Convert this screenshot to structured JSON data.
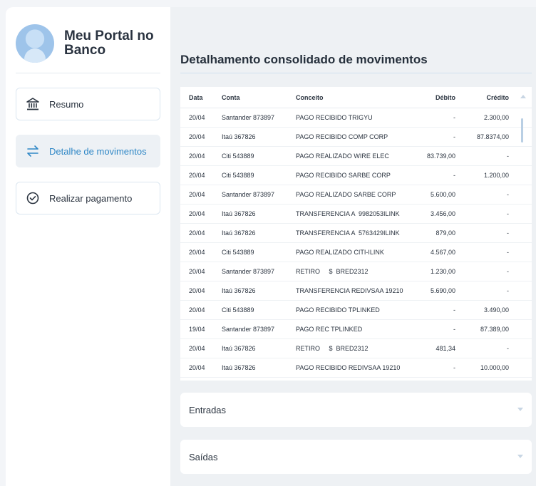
{
  "sidebar": {
    "brand": "Meu Portal no Banco",
    "items": [
      {
        "label": "Resumo",
        "icon": "bank-icon"
      },
      {
        "label": "Detalhe de movimentos",
        "icon": "transfer-arrows-icon"
      },
      {
        "label": "Realizar pagamento",
        "icon": "check-circle-icon"
      }
    ]
  },
  "main": {
    "title": "Detalhamento consolidado de movimentos",
    "table": {
      "headers": [
        "Data",
        "Conta",
        "Conceito",
        "Débito",
        "Crédito"
      ],
      "rows": [
        [
          "20/04",
          "Santander 873897",
          "PAGO RECIBIDO TRIGYU",
          "-",
          "2.300,00"
        ],
        [
          "20/04",
          "Itaú 367826",
          "PAGO RECIBIDO COMP CORP",
          "-",
          "87.8374,00"
        ],
        [
          "20/04",
          "Citi 543889",
          "PAGO REALIZADO WIRE ELEC",
          "83.739,00",
          "-"
        ],
        [
          "20/04",
          "Citi 543889",
          "PAGO RECIBIDO SARBE CORP",
          "-",
          "1.200,00"
        ],
        [
          "20/04",
          "Santander 873897",
          "PAGO REALIZADO SARBE CORP",
          "5.600,00",
          "-"
        ],
        [
          "20/04",
          "Itaú 367826",
          "TRANSFERENCIA A  9982053ILINK",
          "3.456,00",
          "-"
        ],
        [
          "20/04",
          "Itaú 367826",
          "TRANSFERENCIA A  5763429ILINK",
          "879,00",
          "-"
        ],
        [
          "20/04",
          "Citi 543889",
          "PAGO REALIZADO CITI-ILINK",
          "4.567,00",
          "-"
        ],
        [
          "20/04",
          "Santander 873897",
          "RETIRO     $  BRED2312",
          "1.230,00",
          "-"
        ],
        [
          "20/04",
          "Itaú 367826",
          "TRANSFERENCIA REDIVSAA 19210",
          "5.690,00",
          "-"
        ],
        [
          "20/04",
          "Citi 543889",
          "PAGO RECIBIDO TPLINKED",
          "-",
          "3.490,00"
        ],
        [
          "19/04",
          "Santander 873897",
          "PAGO REC TPLINKED",
          "-",
          "87.389,00"
        ],
        [
          "20/04",
          "Itaú 367826",
          "RETIRO     $  BRED2312",
          "481,34",
          "-"
        ],
        [
          "20/04",
          "Itaú 367826",
          "PAGO RECIBIDO REDIVSAA 19210",
          "-",
          "10.000,00"
        ]
      ]
    },
    "accordions": [
      {
        "label": "Entradas"
      },
      {
        "label": "Saídas"
      }
    ]
  },
  "colors": {
    "accent": "#2f87c6",
    "background": "#eef1f4",
    "border": "#dbe6f0"
  }
}
